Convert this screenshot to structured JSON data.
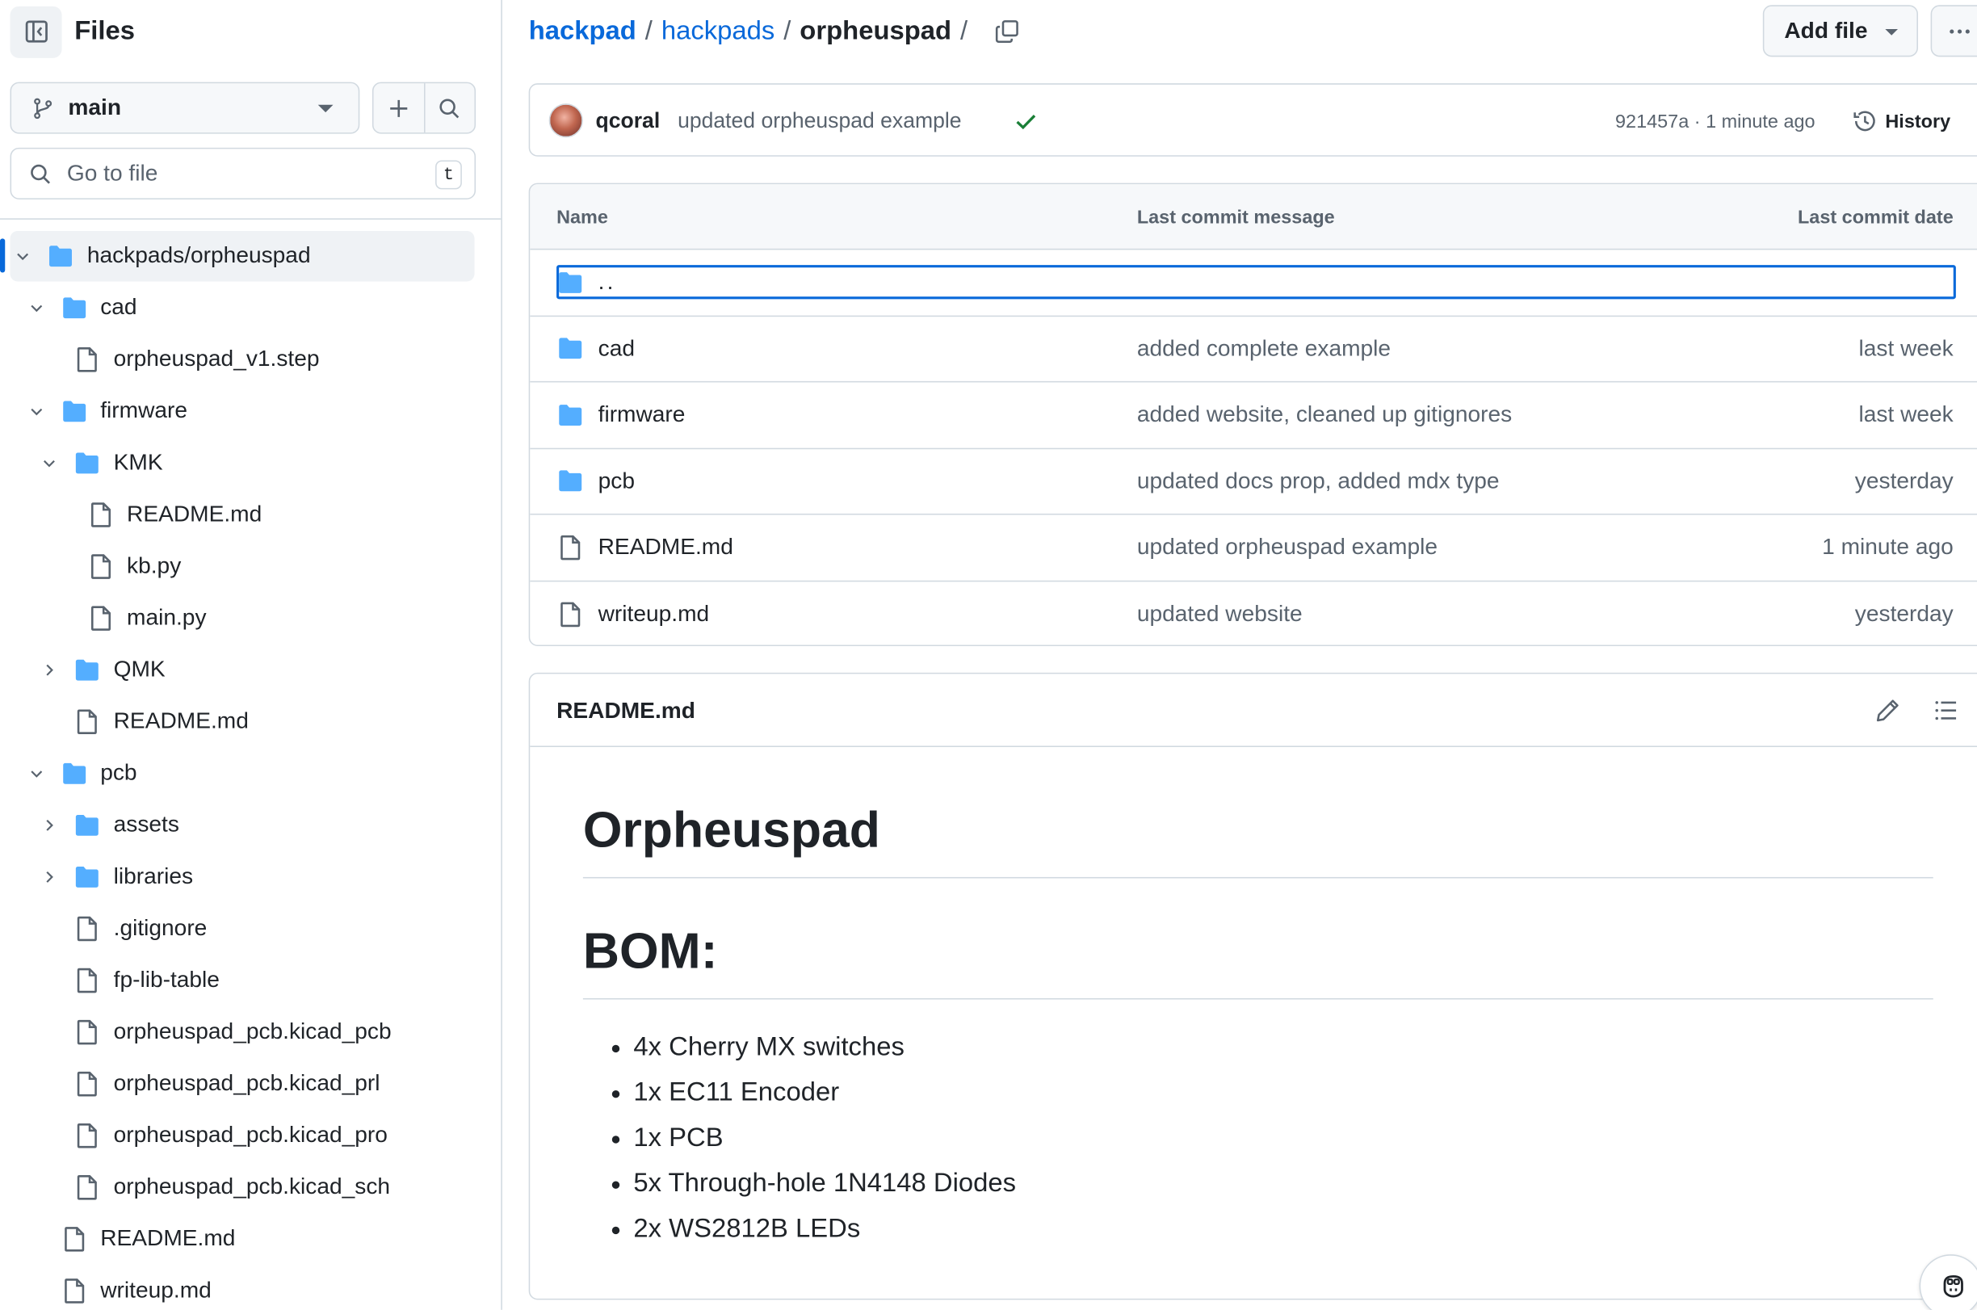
{
  "sidebar": {
    "title": "Files",
    "branch": "main",
    "goto_placeholder": "Go to file",
    "goto_shortcut": "t",
    "tree": [
      {
        "label": "hackpads/orpheuspad",
        "type": "folder",
        "depth": 0,
        "expanded": true,
        "selected": true
      },
      {
        "label": "cad",
        "type": "folder",
        "depth": 1,
        "expanded": true
      },
      {
        "label": "orpheuspad_v1.step",
        "type": "file",
        "depth": 2
      },
      {
        "label": "firmware",
        "type": "folder",
        "depth": 1,
        "expanded": true
      },
      {
        "label": "KMK",
        "type": "folder",
        "depth": 2,
        "expanded": true
      },
      {
        "label": "README.md",
        "type": "file",
        "depth": 3
      },
      {
        "label": "kb.py",
        "type": "file",
        "depth": 3
      },
      {
        "label": "main.py",
        "type": "file",
        "depth": 3
      },
      {
        "label": "QMK",
        "type": "folder",
        "depth": 2,
        "expanded": false
      },
      {
        "label": "README.md",
        "type": "file",
        "depth": 2
      },
      {
        "label": "pcb",
        "type": "folder",
        "depth": 1,
        "expanded": true
      },
      {
        "label": "assets",
        "type": "folder",
        "depth": 2,
        "expanded": false
      },
      {
        "label": "libraries",
        "type": "folder",
        "depth": 2,
        "expanded": false
      },
      {
        "label": ".gitignore",
        "type": "file",
        "depth": 2
      },
      {
        "label": "fp-lib-table",
        "type": "file",
        "depth": 2
      },
      {
        "label": "orpheuspad_pcb.kicad_pcb",
        "type": "file",
        "depth": 2
      },
      {
        "label": "orpheuspad_pcb.kicad_prl",
        "type": "file",
        "depth": 2
      },
      {
        "label": "orpheuspad_pcb.kicad_pro",
        "type": "file",
        "depth": 2
      },
      {
        "label": "orpheuspad_pcb.kicad_sch",
        "type": "file",
        "depth": 2
      },
      {
        "label": "README.md",
        "type": "file",
        "depth": 1
      },
      {
        "label": "writeup.md",
        "type": "file",
        "depth": 1
      }
    ]
  },
  "breadcrumb": {
    "repo": "hackpad",
    "folder": "hackpads",
    "current": "orpheuspad",
    "sep": "/"
  },
  "toolbar": {
    "add_file": "Add file"
  },
  "commit": {
    "author": "qcoral",
    "message": "updated orpheuspad example",
    "sha_time": "921457a · 1 minute ago",
    "history": "History"
  },
  "table": {
    "headers": {
      "name": "Name",
      "message": "Last commit message",
      "date": "Last commit date"
    },
    "parent": "..",
    "rows": [
      {
        "name": "cad",
        "type": "folder",
        "message": "added complete example",
        "date": "last week"
      },
      {
        "name": "firmware",
        "type": "folder",
        "message": "added website, cleaned up gitignores",
        "date": "last week"
      },
      {
        "name": "pcb",
        "type": "folder",
        "message": "updated docs prop, added mdx type",
        "date": "yesterday"
      },
      {
        "name": "README.md",
        "type": "file",
        "message": "updated orpheuspad example",
        "date": "1 minute ago"
      },
      {
        "name": "writeup.md",
        "type": "file",
        "message": "updated website",
        "date": "yesterday"
      }
    ]
  },
  "readme": {
    "filename": "README.md",
    "h1": "Orpheuspad",
    "h2": "BOM:",
    "bom": [
      "4x Cherry MX switches",
      "1x EC11 Encoder",
      "1x PCB",
      "5x Through-hole 1N4148 Diodes",
      "2x WS2812B LEDs"
    ]
  },
  "colors": {
    "accent": "#0969da",
    "folder": "#54aeff",
    "success": "#1a7f37",
    "muted": "#59636e",
    "border": "#d1d9e0"
  },
  "icons": [
    "sidebar-collapse-icon",
    "git-branch-icon",
    "plus-icon",
    "search-icon",
    "folder-icon",
    "file-icon",
    "chevron-down-icon",
    "chevron-right-icon",
    "copy-icon",
    "kebab-horizontal-icon",
    "check-icon",
    "history-icon",
    "pencil-icon",
    "list-unordered-icon",
    "copilot-icon"
  ]
}
